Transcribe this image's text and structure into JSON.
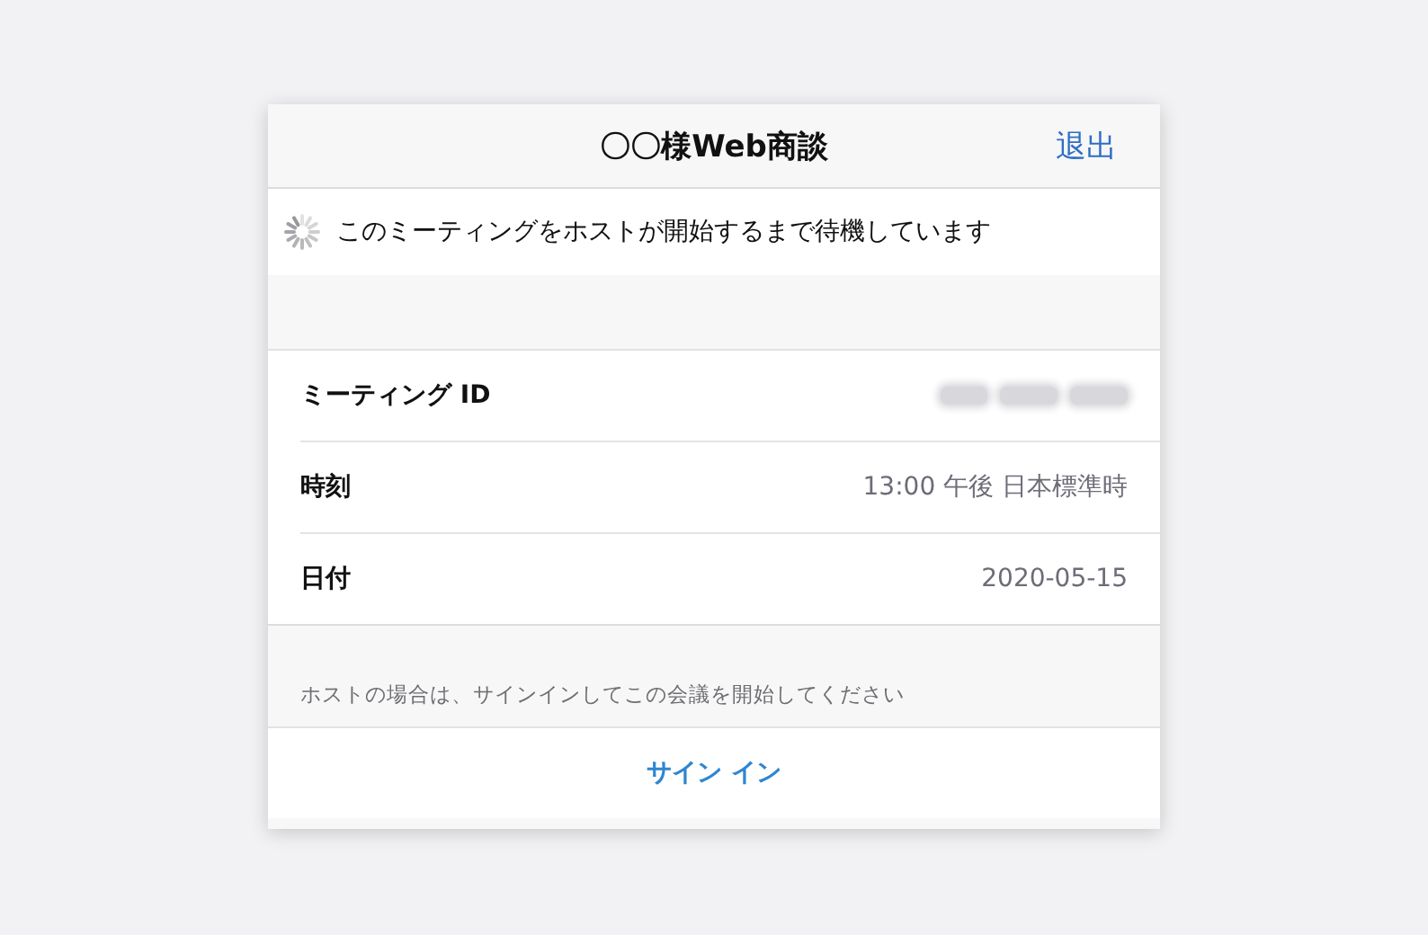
{
  "header": {
    "title": "〇〇様Web商談",
    "action": "退出"
  },
  "status": {
    "message": "このミーティングをホストが開始するまで待機しています"
  },
  "details": [
    {
      "label": "ミーティング ID",
      "blurred": true
    },
    {
      "label": "時刻",
      "value": "13:00 午後 日本標準時",
      "blurred": false
    },
    {
      "label": "日付",
      "value": "2020-05-15",
      "blurred": false
    }
  ],
  "note": "ホストの場合は、サインインしてこの会議を開始してください",
  "sign_in_button": "サイン イン"
}
